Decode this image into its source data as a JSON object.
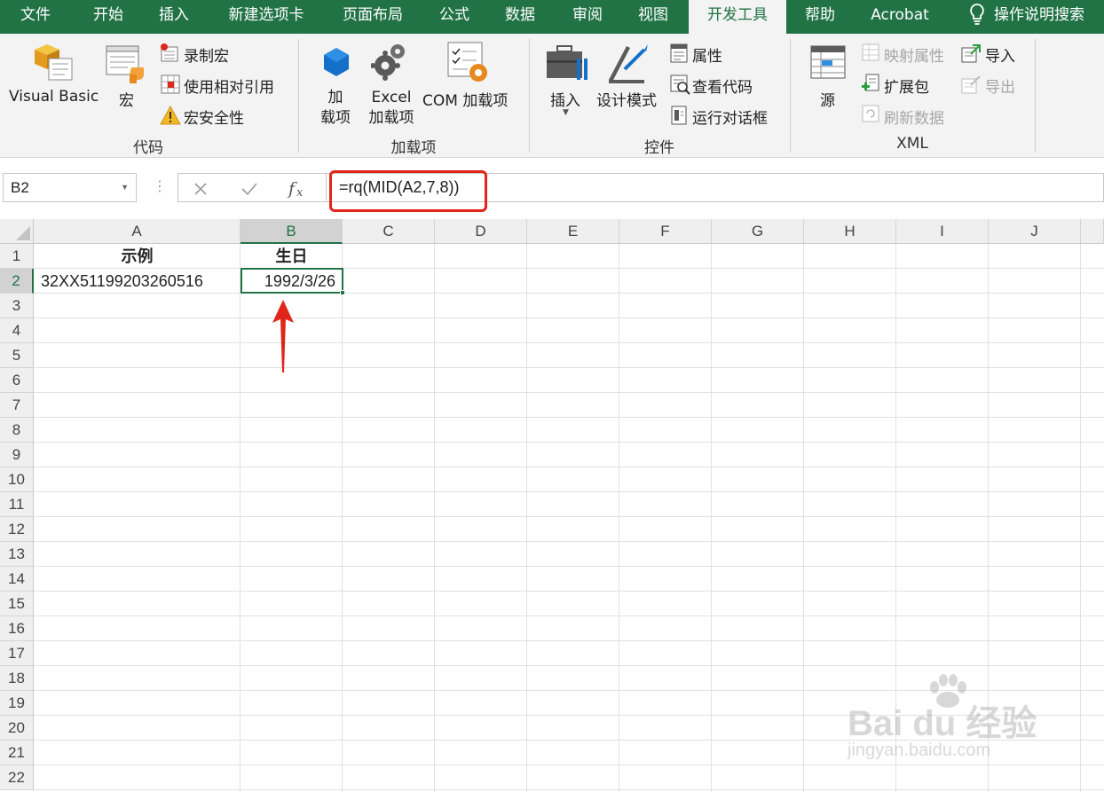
{
  "menu": {
    "tabs": [
      "文件",
      "开始",
      "插入",
      "新建选项卡",
      "页面布局",
      "公式",
      "数据",
      "审阅",
      "视图",
      "开发工具",
      "帮助",
      "Acrobat"
    ],
    "active_tab": "开发工具",
    "tell_me": "操作说明搜索"
  },
  "ribbon": {
    "code": {
      "label": "代码",
      "visual_basic": "Visual Basic",
      "macros": "宏",
      "record_macro": "录制宏",
      "relative_refs": "使用相对引用",
      "macro_security": "宏安全性"
    },
    "addins": {
      "label": "加载项",
      "addins_line1": "加",
      "addins_line2": "载项",
      "excel_addins_line1": "Excel",
      "excel_addins_line2": "加载项",
      "com_addins": "COM 加载项"
    },
    "controls": {
      "label": "控件",
      "insert": "插入",
      "design_mode": "设计模式",
      "properties": "属性",
      "view_code": "查看代码",
      "run_dialog": "运行对话框"
    },
    "xml": {
      "label": "XML",
      "source": "源",
      "map_properties": "映射属性",
      "expansion_packs": "扩展包",
      "refresh_data": "刷新数据",
      "import": "导入",
      "export": "导出"
    }
  },
  "formula_bar": {
    "name_box": "B2",
    "formula": "=rq(MID(A2,7,8))"
  },
  "sheet": {
    "columns": [
      "A",
      "B",
      "C",
      "D",
      "E",
      "F",
      "G",
      "H",
      "I",
      "J"
    ],
    "selected_column": "B",
    "rows": [
      "1",
      "2",
      "3",
      "4",
      "5",
      "6",
      "7",
      "8",
      "9",
      "10",
      "11",
      "12",
      "13",
      "14",
      "15",
      "16",
      "17",
      "18",
      "19",
      "20",
      "21",
      "22"
    ],
    "selected_row": "2",
    "cells": {
      "A1": "示例",
      "B1": "生日",
      "A2": "32XX51199203260516",
      "B2": "1992/3/26"
    }
  },
  "watermark": {
    "brand": "Bai du 经验",
    "url": "jingyan.baidu.com"
  },
  "colors": {
    "accent": "#217346",
    "highlight": "#e0261b"
  }
}
